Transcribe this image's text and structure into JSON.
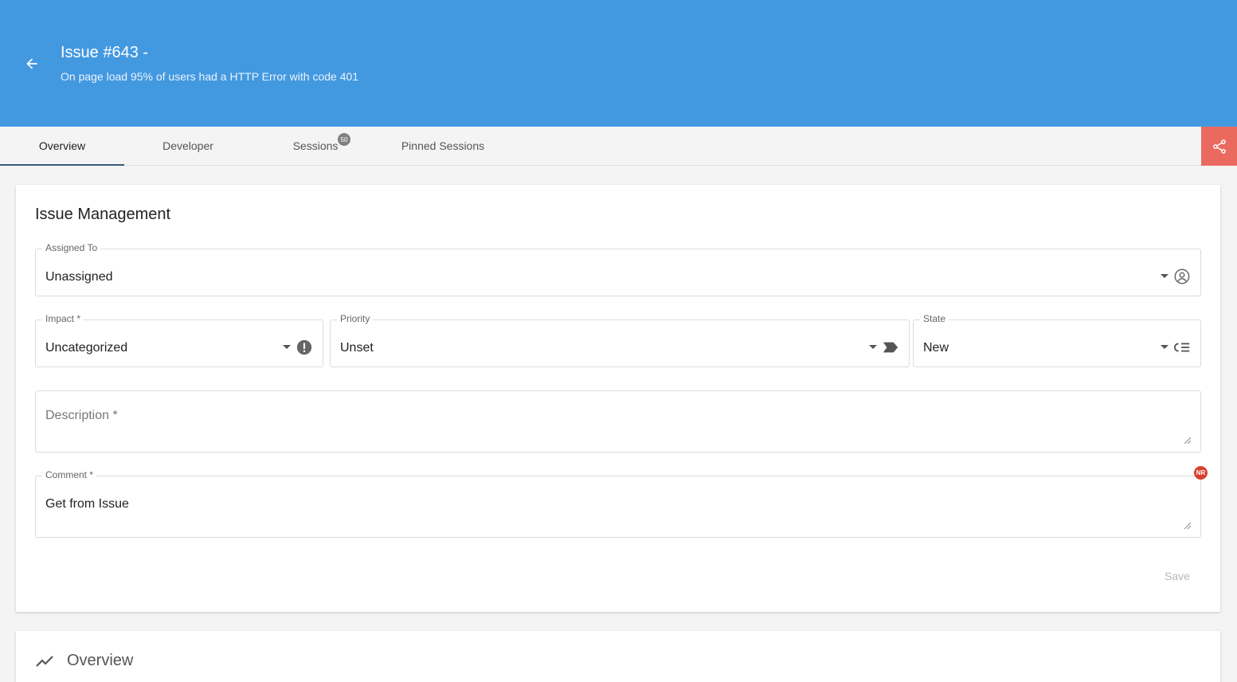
{
  "theme": {
    "accent": "#4399e0",
    "share": "#ea6a60",
    "badge": "#d9412f"
  },
  "header": {
    "title": "Issue #643 -",
    "subtitle": "On page load 95% of users had a HTTP Error with code 401",
    "back_icon": "arrow-left-icon"
  },
  "tabs": [
    {
      "label": "Overview",
      "active": true
    },
    {
      "label": "Developer",
      "active": false
    },
    {
      "label": "Sessions",
      "active": false,
      "badge": "50"
    },
    {
      "label": "Pinned Sessions",
      "active": false
    }
  ],
  "share_icon": "share-icon",
  "issue_management": {
    "title": "Issue Management",
    "assigned_to": {
      "label": "Assigned To",
      "value": "Unassigned",
      "icon": "user-circle-icon"
    },
    "impact": {
      "label": "Impact *",
      "value": "Uncategorized",
      "icon": "alert-circle-icon"
    },
    "priority": {
      "label": "Priority",
      "value": "Unset",
      "icon": "label-tag-icon"
    },
    "state": {
      "label": "State",
      "value": "New",
      "icon": "list-status-icon"
    },
    "description": {
      "placeholder": "Description *",
      "value": ""
    },
    "comment": {
      "label": "Comment *",
      "value": "Get from Issue",
      "badge": "NR"
    },
    "save_label": "Save"
  },
  "overview_section": {
    "title": "Overview",
    "icon": "trending-up-icon"
  }
}
